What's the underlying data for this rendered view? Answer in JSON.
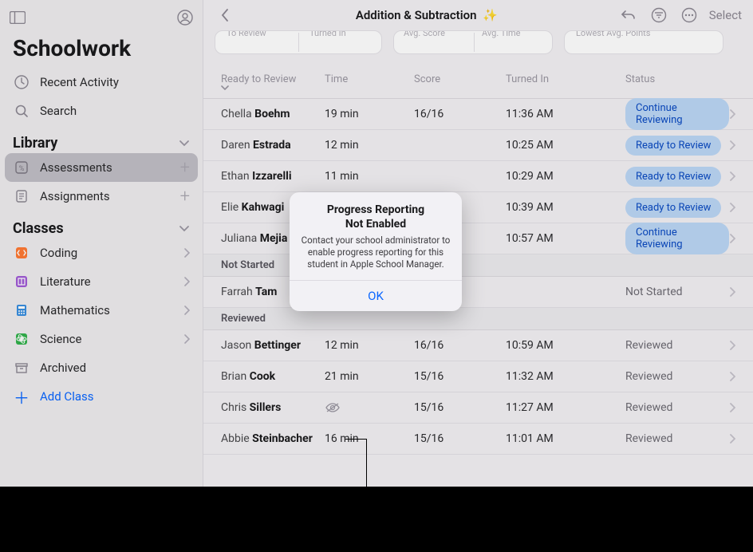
{
  "app": {
    "title": "Schoolwork"
  },
  "sidebar": {
    "top_items": [
      {
        "label": "Recent Activity",
        "icon": "clock-icon"
      },
      {
        "label": "Search",
        "icon": "search-icon"
      }
    ],
    "sections": {
      "library": {
        "label": "Library",
        "items": [
          {
            "label": "Assessments",
            "icon": "assessments-icon",
            "selected": true,
            "add": true
          },
          {
            "label": "Assignments",
            "icon": "assignments-icon",
            "add": true
          }
        ]
      },
      "classes": {
        "label": "Classes",
        "items": [
          {
            "label": "Coding",
            "icon": "coding-icon"
          },
          {
            "label": "Literature",
            "icon": "literature-icon"
          },
          {
            "label": "Mathematics",
            "icon": "mathematics-icon"
          },
          {
            "label": "Science",
            "icon": "science-icon"
          },
          {
            "label": "Archived",
            "icon": "archived-icon"
          }
        ],
        "add_label": "Add Class"
      }
    }
  },
  "header": {
    "title": "Addition & Subtraction",
    "sparkle": "✨",
    "select": "Select"
  },
  "summary_cards": {
    "c1": {
      "left": "To Review",
      "right": "Turned In"
    },
    "c2": {
      "left": "Avg. Score",
      "right": "Avg. Time"
    },
    "c3": {
      "left": "Lowest Avg. Points"
    }
  },
  "table": {
    "headers": {
      "ready": "Ready to Review",
      "time": "Time",
      "score": "Score",
      "turned": "Turned In",
      "status": "Status"
    },
    "rows_ready": [
      {
        "first": "Chella",
        "last": "Boehm",
        "time": "19 min",
        "score": "16/16",
        "turned": "11:36 AM",
        "status": "Continue Reviewing"
      },
      {
        "first": "Daren",
        "last": "Estrada",
        "time": "12 min",
        "score": "",
        "turned": "10:25 AM",
        "status": "Ready to Review"
      },
      {
        "first": "Ethan",
        "last": "Izzarelli",
        "time": "11 min",
        "score": "",
        "turned": "10:29 AM",
        "status": "Ready to Review"
      },
      {
        "first": "Elie",
        "last": "Kahwagi",
        "time": "",
        "score": "",
        "turned": "10:39 AM",
        "status": "Ready to Review"
      },
      {
        "first": "Juliana",
        "last": "Mejia",
        "time": "",
        "score": "",
        "turned": "10:57 AM",
        "status": "Continue Reviewing"
      }
    ],
    "section_not_started": "Not Started",
    "rows_not_started": [
      {
        "first": "Farrah",
        "last": "Tam",
        "time": "",
        "score": "",
        "turned": "",
        "status": "Not Started"
      }
    ],
    "section_reviewed": "Reviewed",
    "rows_reviewed": [
      {
        "first": "Jason",
        "last": "Bettinger",
        "time": "12 min",
        "score": "16/16",
        "turned": "10:59 AM",
        "status": "Reviewed"
      },
      {
        "first": "Brian",
        "last": "Cook",
        "time": "21 min",
        "score": "15/16",
        "turned": "11:32 AM",
        "status": "Reviewed"
      },
      {
        "first": "Chris",
        "last": "Sillers",
        "time": "",
        "score": "15/16",
        "turned": "11:27 AM",
        "status": "Reviewed",
        "eye_off": true
      },
      {
        "first": "Abbie",
        "last": "Steinbacher",
        "time": "16 min",
        "score": "15/16",
        "turned": "11:01 AM",
        "status": "Reviewed"
      }
    ]
  },
  "modal": {
    "title_l1": "Progress Reporting",
    "title_l2": "Not Enabled",
    "message": "Contact your school administrator to enable progress reporting for this student in Apple School Manager.",
    "ok": "OK"
  }
}
